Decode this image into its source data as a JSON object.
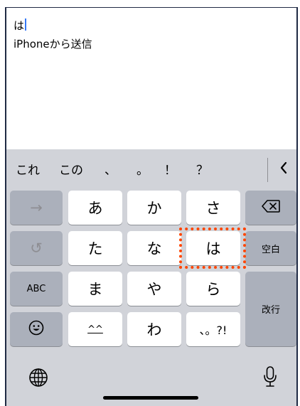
{
  "compose": {
    "typed_text": "は",
    "signature": "iPhoneから送信"
  },
  "candidates": [
    "これ",
    "この",
    "、",
    "。",
    "！",
    "？"
  ],
  "keys": {
    "next_arrow": "→",
    "a": "あ",
    "ka": "か",
    "sa": "さ",
    "undo": "↺",
    "ta": "た",
    "na": "な",
    "ha": "は",
    "space": "空白",
    "abc": "ABC",
    "ma": "ま",
    "ya": "や",
    "ra": "ら",
    "return": "改行",
    "kaomoji": "^^",
    "wa": "わ",
    "punct": "、。?!"
  },
  "icons": {
    "backspace": "delete-left-icon",
    "emoji": "emoji-icon",
    "globe": "globe-icon",
    "mic": "microphone-icon",
    "collapse": "chevron-left-icon"
  },
  "colors": {
    "highlight": "#ff4500",
    "caret": "#3478f6",
    "keyboard_bg": "#d1d3d9",
    "dark_key": "#abb0bb"
  }
}
